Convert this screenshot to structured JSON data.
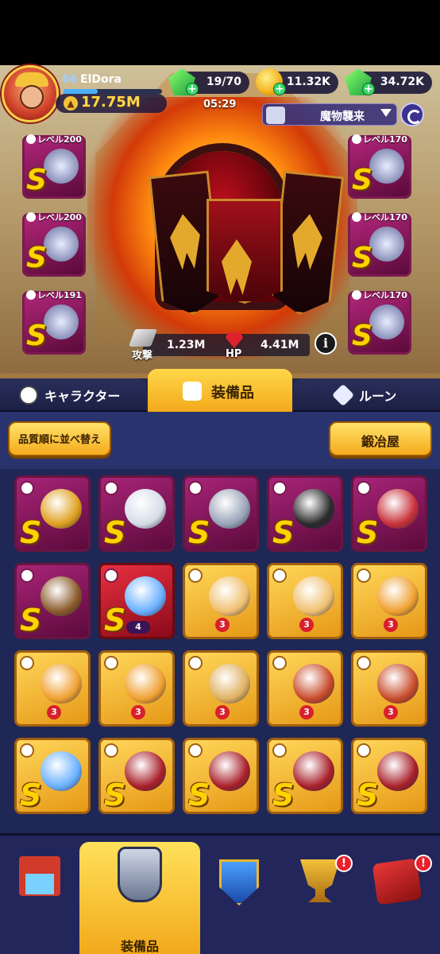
{
  "player": {
    "level": "66",
    "name": "ElDora",
    "xp_fraction": 0.35,
    "power": "17.75M"
  },
  "resources": {
    "energy": "19/70",
    "gold": "11.32K",
    "gems": "34.72K"
  },
  "timer": "05:29",
  "event": {
    "label": "魔物襲来"
  },
  "equipped": {
    "left": [
      {
        "level": "レベル200",
        "grade": "S",
        "item": "armor-piece-icon"
      },
      {
        "level": "レベル200",
        "grade": "S",
        "item": "necklace-icon"
      },
      {
        "level": "レベル191",
        "grade": "S",
        "item": "ring-icon"
      }
    ],
    "right": [
      {
        "level": "レベル170",
        "grade": "S",
        "item": "winged-helmet-icon"
      },
      {
        "level": "レベル170",
        "grade": "S",
        "item": "chestplate-icon"
      },
      {
        "level": "レベル170",
        "grade": "S",
        "item": "winged-boots-icon"
      }
    ]
  },
  "stats": {
    "attack_label": "攻撃",
    "attack_value": "1.23M",
    "hp_label": "HP",
    "hp_value": "4.41M"
  },
  "tabs": {
    "character": "キャラクター",
    "equipment": "装備品",
    "runes": "ルーン"
  },
  "toolbar": {
    "sort_label": "品質順に並べ替え",
    "smithy_label": "鍛冶屋"
  },
  "inventory": [
    {
      "grade": "S",
      "style": "S",
      "item": "golden-helmet-icon",
      "color": "#e0a020"
    },
    {
      "grade": "S",
      "style": "S",
      "item": "silver-ring-icon",
      "color": "#d6dce8"
    },
    {
      "grade": "S",
      "style": "S",
      "item": "knight-helmet-icon",
      "color": "#9aa4b8"
    },
    {
      "grade": "S",
      "style": "S",
      "item": "beaded-necklace-icon",
      "color": "#2a2a2a"
    },
    {
      "grade": "S",
      "style": "S",
      "item": "red-boots-icon",
      "color": "#c8303a"
    },
    {
      "grade": "S",
      "style": "S",
      "item": "winged-boots-icon",
      "color": "#8a5a2a"
    },
    {
      "grade": "S",
      "style": "Sred",
      "item": "crystal-staff-icon",
      "color": "#6ab0ff",
      "level": "4"
    },
    {
      "grade": "",
      "style": "G3",
      "item": "chestplate-icon",
      "color": "#f0c070",
      "stars": "3"
    },
    {
      "grade": "",
      "style": "G3",
      "item": "chestplate-icon",
      "color": "#f0c070",
      "stars": "3"
    },
    {
      "grade": "",
      "style": "G3",
      "item": "ring-icon",
      "color": "#f0a030",
      "stars": "3"
    },
    {
      "grade": "",
      "style": "G3",
      "item": "ring-icon",
      "color": "#f0a030",
      "stars": "3"
    },
    {
      "grade": "",
      "style": "G3",
      "item": "ring-icon",
      "color": "#f0a030",
      "stars": "3"
    },
    {
      "grade": "",
      "style": "G3",
      "item": "helmet-icon",
      "color": "#e0b060",
      "stars": "3"
    },
    {
      "grade": "",
      "style": "G3",
      "item": "necklace-icon",
      "color": "#c84a2a",
      "stars": "3"
    },
    {
      "grade": "",
      "style": "G3",
      "item": "necklace-icon",
      "color": "#c84a2a",
      "stars": "3"
    },
    {
      "grade": "S",
      "style": "S2",
      "item": "crystal-staff-icon",
      "color": "#6ab0ff"
    },
    {
      "grade": "S",
      "style": "S2",
      "item": "demon-armor-icon",
      "color": "#a8202a"
    },
    {
      "grade": "S",
      "style": "S2",
      "item": "demon-armor-icon",
      "color": "#a8202a"
    },
    {
      "grade": "S",
      "style": "S2",
      "item": "demon-armor-icon",
      "color": "#a8202a"
    },
    {
      "grade": "S",
      "style": "S2",
      "item": "demon-armor-icon",
      "color": "#a8202a"
    }
  ],
  "nav": {
    "shop": "shop-icon",
    "equipment_label": "装備品",
    "guild": "shield-icon",
    "trophy": "trophy-icon",
    "events": "box-icon",
    "alert_mark": "!"
  }
}
